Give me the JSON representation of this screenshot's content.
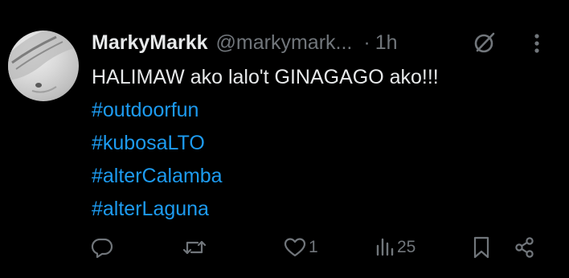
{
  "tweet": {
    "author": {
      "display_name": "MarkyMarkk",
      "handle": "@markymark...",
      "avatar_icon": "profile-photo"
    },
    "separator": "·",
    "time": "1h",
    "lines": [
      {
        "text": "HALIMAW ako lalo't GINAGAGO ako!!!",
        "kind": "text"
      },
      {
        "text": "#outdoorfun",
        "kind": "hashtag"
      },
      {
        "text": "#kubosaLTO",
        "kind": "hashtag"
      },
      {
        "text": "#alterCalamba",
        "kind": "hashtag"
      },
      {
        "text": "#alterLaguna",
        "kind": "hashtag"
      }
    ],
    "actions": {
      "reply": {
        "icon": "reply-icon"
      },
      "repost": {
        "icon": "repost-icon"
      },
      "like": {
        "icon": "heart-icon",
        "count": "1"
      },
      "views": {
        "icon": "views-icon",
        "count": "25"
      },
      "bookmark": {
        "icon": "bookmark-icon"
      },
      "share": {
        "icon": "share-icon"
      }
    }
  },
  "colors": {
    "background": "#000000",
    "text": "#e7e9ea",
    "muted": "#71767b",
    "link": "#1d9bf0"
  }
}
